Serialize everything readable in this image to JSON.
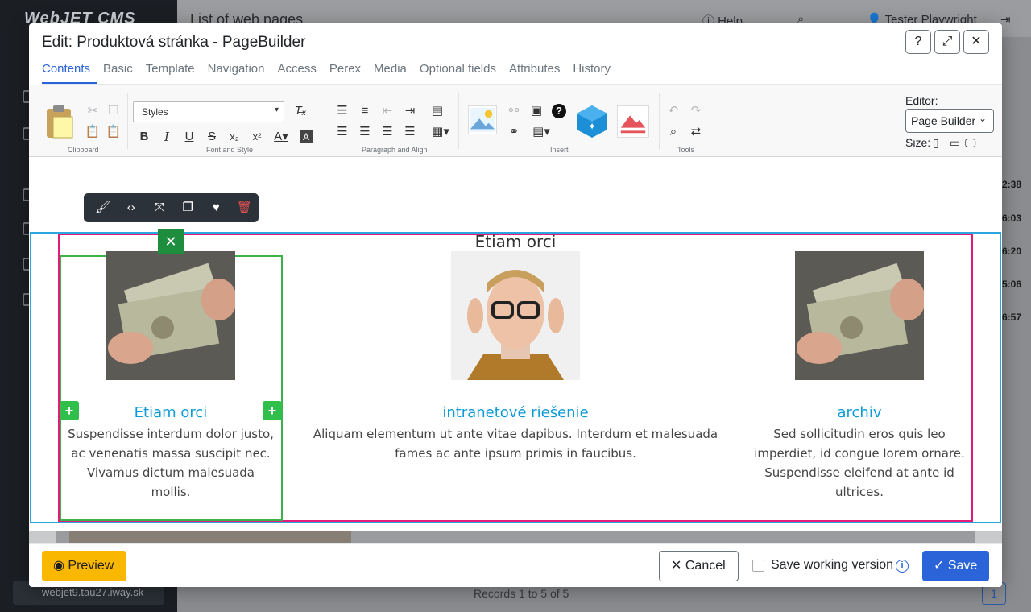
{
  "background": {
    "brand": "WebJET CMS",
    "page_title": "List of web pages",
    "help_label": "Help",
    "user_name": "Tester Playwright",
    "domain": "webjet9.tau27.iway.sk",
    "records": "Records 1 to 5 of 5",
    "page_number": "1",
    "times": [
      "2:38",
      "6:03",
      "6:20",
      "5:06",
      "6:57"
    ]
  },
  "modal": {
    "title": "Edit: Produktová stránka - PageBuilder",
    "tabs": [
      {
        "label": "Contents",
        "active": true
      },
      {
        "label": "Basic"
      },
      {
        "label": "Template"
      },
      {
        "label": "Navigation"
      },
      {
        "label": "Access"
      },
      {
        "label": "Perex"
      },
      {
        "label": "Media"
      },
      {
        "label": "Optional fields"
      },
      {
        "label": "Attributes"
      },
      {
        "label": "History"
      }
    ]
  },
  "toolbar": {
    "styles_value": "Styles",
    "groups": {
      "clipboard": "Clipboard",
      "font_style": "Font and Style",
      "paragraph": "Paragraph and Align",
      "insert": "Insert",
      "tools": "Tools"
    },
    "editor_label": "Editor:",
    "editor_value": "Page Builder",
    "size_label": "Size:"
  },
  "content": {
    "row_heading": "Etiam orci",
    "cards": [
      {
        "title": "Etiam orci",
        "text": "Suspendisse interdum dolor justo, ac venenatis massa suscipit nec. Vivamus dictum malesuada mollis.",
        "image": "money-photo"
      },
      {
        "title": "intranetové riešenie",
        "text": "Aliquam elementum ut ante vitae dapibus. Interdum et malesuada fames ac ante ipsum primis in faucibus.",
        "image": "man-glasses-photo"
      },
      {
        "title": "archiv",
        "text": "Sed sollicitudin eros quis leo imperdiet, id congue lorem ornare. Suspendisse eleifend at ante id ultrices.",
        "image": "money-photo"
      }
    ]
  },
  "footer": {
    "preview_label": "Preview",
    "cancel_label": "Cancel",
    "working_version_label": "Save working version",
    "save_label": "Save"
  },
  "colors": {
    "accent": "#2a64d8",
    "preview": "#f9b700",
    "section_outline": "#2aa7df",
    "container_outline": "#e31c79",
    "column_outline": "#3cb34a",
    "card_title": "#0d9bd7"
  }
}
